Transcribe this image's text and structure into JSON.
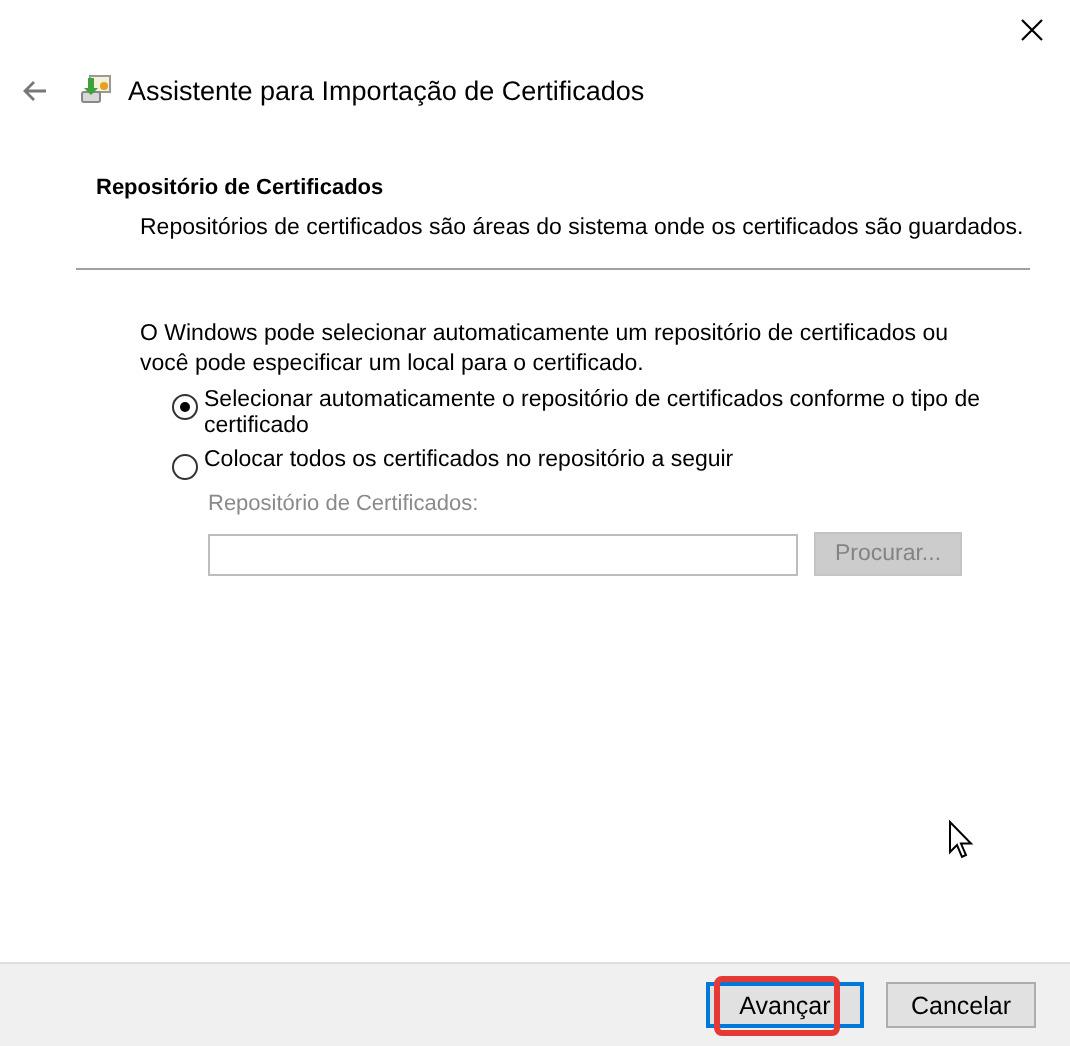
{
  "header": {
    "title": "Assistente para Importação de Certificados"
  },
  "section": {
    "heading": "Repositório de Certificados",
    "description": "Repositórios de certificados são áreas do sistema onde os certificados são guardados."
  },
  "intro": "O Windows pode selecionar automaticamente um repositório de certificados ou você pode especificar um local para o certificado.",
  "options": [
    {
      "label": "Selecionar automaticamente o repositório de certificados conforme o tipo de certificado",
      "selected": true
    },
    {
      "label": "Colocar todos os certificados no repositório a seguir",
      "selected": false
    }
  ],
  "store_field": {
    "label": "Repositório de Certificados:",
    "disabled": true
  },
  "browse_button": {
    "label": "Procurar...",
    "disabled": true
  },
  "buttons": [
    {
      "label": "Avançar",
      "kind": "primary",
      "highlighted": true
    },
    {
      "label": "Cancelar",
      "kind": "secondary",
      "highlighted": false
    }
  ]
}
